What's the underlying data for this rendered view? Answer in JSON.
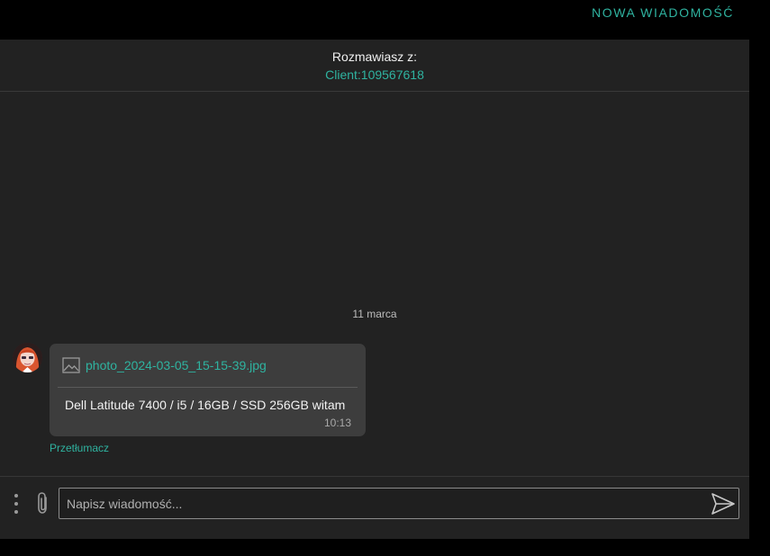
{
  "topbar": {
    "new_message_label": "NOWA WIADOMOŚĆ"
  },
  "chat_header": {
    "chatting_with_label": "Rozmawiasz z:",
    "client_name": "Client:109567618"
  },
  "date_separator": "11 marca",
  "message": {
    "attachment_icon": "image-icon",
    "attachment_name": "photo_2024-03-05_15-15-39.jpg",
    "text": "Dell Latitude 7400 / i5 / 16GB / SSD 256GB witam",
    "time": "10:13",
    "translate_label": "Przetłumacz"
  },
  "composer": {
    "placeholder": "Napisz wiadomość...",
    "icons": [
      "more-vertical-icon",
      "paperclip-icon",
      "send-icon"
    ]
  },
  "colors": {
    "accent": "#2fb3a0",
    "panel": "#222222",
    "bubble": "#3d3d3d",
    "background": "#000000"
  }
}
